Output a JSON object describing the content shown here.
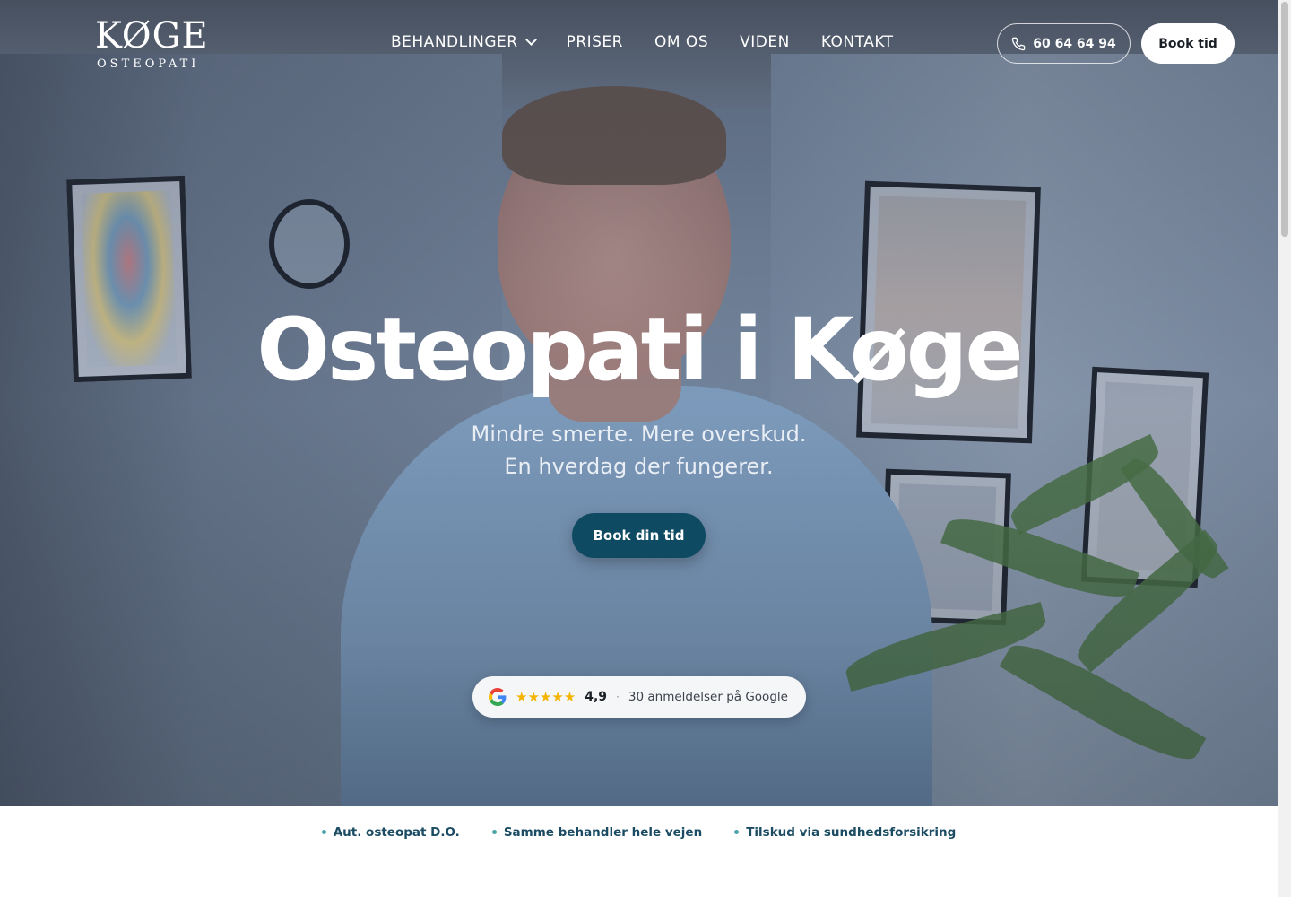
{
  "header": {
    "logo_main": "KØGE",
    "logo_sub": "OSTEOPATI",
    "nav": [
      {
        "label": "BEHANDLINGER",
        "has_dropdown": true
      },
      {
        "label": "PRISER"
      },
      {
        "label": "OM OS"
      },
      {
        "label": "VIDEN"
      },
      {
        "label": "KONTAKT"
      }
    ],
    "phone_label": "60 64 64 94",
    "book_label": "Book tid"
  },
  "hero": {
    "title": "Osteopati i Køge",
    "subtitle_line1": "Mindre smerte. Mere overskud.",
    "subtitle_line2": "En hverdag der fungerer.",
    "cta_label": "Book din tid",
    "rating": {
      "stars": "★★★★★",
      "score": "4,9",
      "separator": "·",
      "reviews_text": "30 anmeldelser på Google"
    }
  },
  "trust_items": [
    "Aut. osteopat D.O.",
    "Samme behandler hele vejen",
    "Tilskud via sundhedsforsikring"
  ],
  "colors": {
    "cta_bg": "#0e4a62",
    "trust_text": "#1b4c63",
    "trust_dot": "#4aa3a8",
    "star": "#f4b400"
  },
  "icons": {
    "phone": "phone-icon",
    "google": "google-icon",
    "dropdown": "chevron-down-icon"
  }
}
